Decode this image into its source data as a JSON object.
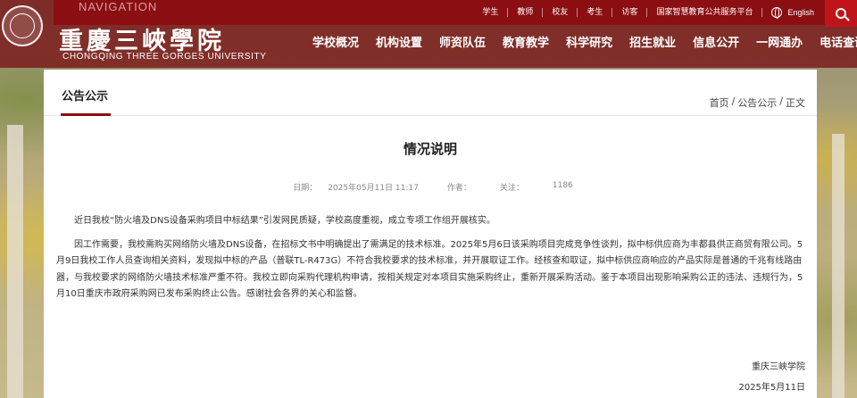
{
  "header": {
    "nav_word": "NAVIGATION",
    "top_links": [
      "学生",
      "教师",
      "校友",
      "考生",
      "访客",
      "国家智慧教育公共服务平台"
    ],
    "language": "English",
    "logo_cn": "重慶三峽學院",
    "logo_en": "CHONGQING THREE GORGES UNIVERSITY",
    "main_nav": [
      "学校概况",
      "机构设置",
      "师资队伍",
      "教育教学",
      "科学研究",
      "招生就业",
      "信息公开",
      "一网通办",
      "电话查询"
    ],
    "icons": [
      "globe-icon",
      "search-icon"
    ]
  },
  "page": {
    "section_title": "公告公示",
    "breadcrumb": [
      "首页",
      "公告公示",
      "正文"
    ],
    "breadcrumb_sep": "/"
  },
  "article": {
    "title": "情况说明",
    "meta": {
      "date_label": "日期：",
      "date": "2025年05月11日 11:17",
      "author_label": "作者：",
      "views_label": "关注：",
      "views": "1186"
    },
    "paragraphs": [
      "近日我校“防火墙及DNS设备采购项目中标结果”引发网民质疑，学校高度重视，成立专项工作组开展核实。",
      "因工作需要，我校需购买网络防火墙及DNS设备，在招标文书中明确提出了需满足的技术标准。2025年5月6日该采购项目完成竞争性谈判，拟中标供应商为丰都县供正商贸有限公司。5月9日我校工作人员查询相关资料，发现拟中标的产品（普联TL-R473G）不符合我校要求的技术标准，并开展取证工作。经核查和取证，拟中标供应商响应的产品实际是普通的千兆有线路由器，与我校要求的网络防火墙技术标准严重不符。我校立即向采购代理机构申请，按相关规定对本项目实施采购终止，重新开展采购活动。鉴于本项目出现影响采购公正的违法、违规行为，5月10日重庆市政府采购网已发布采购终止公告。感谢社会各界的关心和监督。"
    ],
    "sign_org": "重庆三峡学院",
    "sign_date": "2025年5月11日"
  }
}
